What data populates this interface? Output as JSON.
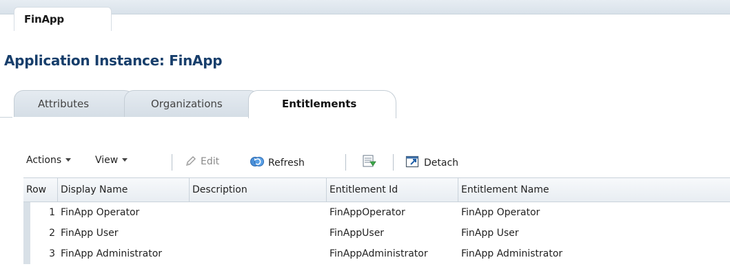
{
  "window": {
    "tab_label": "FinApp"
  },
  "page": {
    "title": "Application Instance: FinApp"
  },
  "tabs": [
    {
      "label": "Attributes",
      "selected": false
    },
    {
      "label": "Organizations",
      "selected": false
    },
    {
      "label": "Entitlements",
      "selected": true
    }
  ],
  "toolbar": {
    "actions_label": "Actions",
    "view_label": "View",
    "edit_label": "Edit",
    "refresh_label": "Refresh",
    "detach_label": "Detach",
    "icons": {
      "edit": "pencil-icon",
      "refresh": "refresh-icon",
      "export": "export-icon",
      "detach": "detach-icon"
    }
  },
  "table": {
    "columns": [
      "Row",
      "Display Name",
      "Description",
      "Entitlement Id",
      "Entitlement Name"
    ],
    "rows": [
      {
        "row": "1",
        "display_name": "FinApp Operator",
        "description": "",
        "entitlement_id": "FinAppOperator",
        "entitlement_name": "FinApp Operator"
      },
      {
        "row": "2",
        "display_name": "FinApp User",
        "description": "",
        "entitlement_id": "FinAppUser",
        "entitlement_name": "FinApp User"
      },
      {
        "row": "3",
        "display_name": "FinApp Administrator",
        "description": "",
        "entitlement_id": "FinAppAdministrator",
        "entitlement_name": "FinApp Administrator"
      }
    ]
  },
  "colors": {
    "title": "#173e6b",
    "tab_bg": "#dfe6ed",
    "header_border": "#c9d2da"
  }
}
